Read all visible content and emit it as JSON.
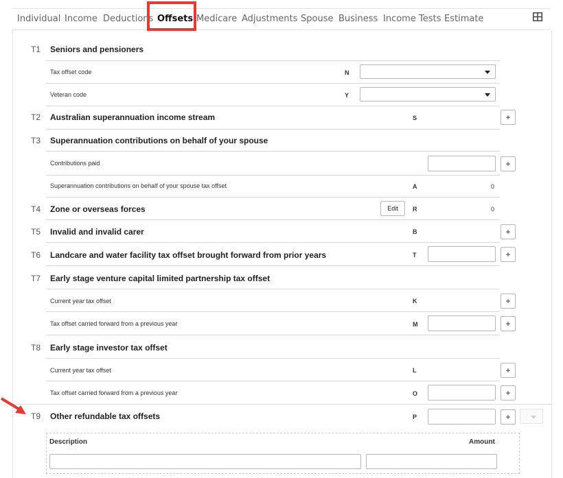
{
  "tabs": [
    {
      "label": "Individual"
    },
    {
      "label": "Income"
    },
    {
      "label": "Deductions"
    },
    {
      "label": "Offsets"
    },
    {
      "label": "Medicare"
    },
    {
      "label": "Adjustments"
    },
    {
      "label": "Spouse"
    },
    {
      "label": "Business"
    },
    {
      "label": "Income Tests"
    },
    {
      "label": "Estimate"
    }
  ],
  "active_tab": "Offsets",
  "icons": {
    "layout": "grid-icon",
    "add": "plus-icon",
    "dropdown": "caret-down-icon",
    "annotation": "red-arrow-icon"
  },
  "colors": {
    "highlight": "#e53935",
    "arrow": "#e53935"
  },
  "sections": {
    "t1": {
      "code": "T1",
      "title": "Seniors and pensioners",
      "tax_offset_code": {
        "label": "Tax offset code",
        "letter": "N",
        "value": ""
      },
      "veteran_code": {
        "label": "Veteran code",
        "letter": "Y",
        "value": ""
      }
    },
    "t2": {
      "code": "T2",
      "title": "Australian superannuation income stream",
      "letter": "S"
    },
    "t3": {
      "code": "T3",
      "title": "Superannuation contributions on behalf of your spouse",
      "contributions_paid": {
        "label": "Contributions paid",
        "value": ""
      },
      "offset": {
        "label": "Superannuation contributions on behalf of your spouse tax offset",
        "letter": "A",
        "value": "0"
      }
    },
    "t4": {
      "code": "T4",
      "title": "Zone or overseas forces",
      "edit_label": "Edit",
      "letter": "R",
      "value": "0"
    },
    "t5": {
      "code": "T5",
      "title": "Invalid and invalid carer",
      "letter": "B"
    },
    "t6": {
      "code": "T6",
      "title": "Landcare and water facility tax offset brought forward from prior years",
      "letter": "T",
      "value": ""
    },
    "t7": {
      "code": "T7",
      "title": "Early stage venture capital limited partnership tax offset",
      "current": {
        "label": "Current year tax offset",
        "letter": "K"
      },
      "carried": {
        "label": "Tax offset carried forward from a previous year",
        "letter": "M",
        "value": ""
      }
    },
    "t8": {
      "code": "T8",
      "title": "Early stage investor tax offset",
      "current": {
        "label": "Current year tax offset",
        "letter": "L"
      },
      "carried": {
        "label": "Tax offset carried forward from a previous year",
        "letter": "O",
        "value": ""
      }
    },
    "t9": {
      "code": "T9",
      "title": "Other refundable tax offsets",
      "letter": "P",
      "value": "",
      "description_header": "Description",
      "amount_header": "Amount",
      "description_value": "",
      "amount_value": ""
    }
  },
  "plus_label": "+"
}
